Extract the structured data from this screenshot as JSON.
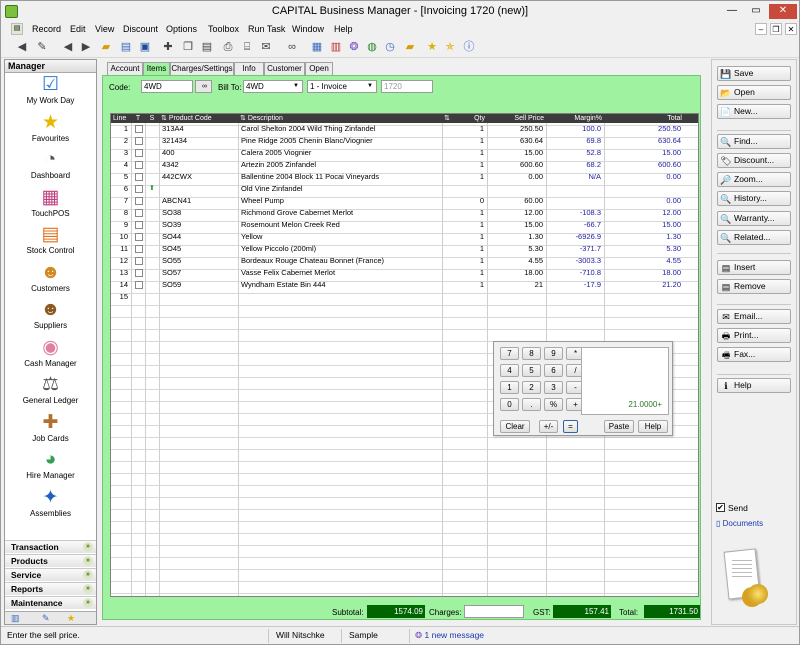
{
  "window": {
    "title": "CAPITAL Business Manager - [Invoicing 1720 (new)]",
    "minimize": "—",
    "restore": "▭",
    "close": "✕",
    "child_minimize": "–",
    "child_restore": "❐",
    "child_close": "✕"
  },
  "menu": [
    "Record",
    "Edit",
    "View",
    "Discount",
    "Options",
    "Toolbox",
    "Run Task",
    "Window",
    "Help"
  ],
  "left_panel": {
    "header": "Manager",
    "items": [
      {
        "label": "My Work Day",
        "icon": "☑",
        "color": "#2d7ad6"
      },
      {
        "label": "Favourites",
        "icon": "★",
        "color": "#e6b800"
      },
      {
        "label": "Dashboard",
        "icon": "◔",
        "color": "#555555"
      },
      {
        "label": "TouchPOS",
        "icon": "▦",
        "color": "#c04080"
      },
      {
        "label": "Stock Control",
        "icon": "▤",
        "color": "#e07020"
      },
      {
        "label": "Customers",
        "icon": "☻",
        "color": "#d08a20"
      },
      {
        "label": "Suppliers",
        "icon": "☻",
        "color": "#8a5a20"
      },
      {
        "label": "Cash Manager",
        "icon": "◉",
        "color": "#e080a0"
      },
      {
        "label": "General Ledger",
        "icon": "⚖",
        "color": "#555555"
      },
      {
        "label": "Job Cards",
        "icon": "✚",
        "color": "#b07030"
      },
      {
        "label": "Hire Manager",
        "icon": "◕",
        "color": "#30a050"
      },
      {
        "label": "Assemblies",
        "icon": "✦",
        "color": "#2060c0"
      }
    ],
    "categories": [
      "Transaction",
      "Products",
      "Service",
      "Reports",
      "Maintenance"
    ]
  },
  "tabs": [
    "Account",
    "Items",
    "Charges/Settings",
    "Info",
    "Customer",
    "Open"
  ],
  "active_tab": "Items",
  "header": {
    "code_label": "Code:",
    "code_value": "4WD",
    "bill_to_label": "Bill To:",
    "bill_to_value": "4WD",
    "doc_type": "1 - Invoice",
    "doc_number": "1720"
  },
  "grid": {
    "columns": [
      "Line",
      "T",
      "S",
      "Product Code",
      "Description",
      "Qty",
      "Sell Price",
      "Margin%",
      "Total"
    ],
    "rows": [
      {
        "line": "1",
        "arrow": "",
        "code": "313A4",
        "desc": "Carol Shelton 2004 Wild Thing Zinfandel",
        "qty": "1",
        "price": "250.50",
        "margin": "100.0",
        "total": "250.50"
      },
      {
        "line": "2",
        "arrow": "",
        "code": "321434",
        "desc": "Pine Ridge 2005 Chenin Blanc/Viognier",
        "qty": "1",
        "price": "630.64",
        "margin": "69.8",
        "total": "630.64"
      },
      {
        "line": "3",
        "arrow": "",
        "code": "400",
        "desc": "Calera 2005 Viognier",
        "qty": "1",
        "price": "15.00",
        "margin": "52.8",
        "total": "15.00"
      },
      {
        "line": "4",
        "arrow": "",
        "code": "4342",
        "desc": "Artezin 2005 Zinfandel",
        "qty": "1",
        "price": "600.60",
        "margin": "68.2",
        "total": "600.60"
      },
      {
        "line": "5",
        "arrow": "",
        "code": "442CWX",
        "desc": "Ballentine 2004 Block 11 Pocai Vineyards",
        "qty": "1",
        "price": "0.00",
        "margin": "N/A",
        "total": "0.00"
      },
      {
        "line": "6",
        "arrow": "⬆",
        "code": "",
        "desc": "Old Vine Zinfandel",
        "qty": "",
        "price": "",
        "margin": "",
        "total": ""
      },
      {
        "line": "7",
        "arrow": "",
        "code": "ABCN41",
        "desc": "Wheel Pump",
        "qty": "0",
        "price": "60.00",
        "margin": "",
        "total": "0.00"
      },
      {
        "line": "8",
        "arrow": "",
        "code": "SO38",
        "desc": "Richmond Grove Cabernet Merlot",
        "qty": "1",
        "price": "12.00",
        "margin": "-108.3",
        "total": "12.00"
      },
      {
        "line": "9",
        "arrow": "",
        "code": "SO39",
        "desc": "Rosemount Melon Creek Red",
        "qty": "1",
        "price": "15.00",
        "margin": "-66.7",
        "total": "15.00"
      },
      {
        "line": "10",
        "arrow": "",
        "code": "SO44",
        "desc": "Yellow",
        "qty": "1",
        "price": "1.30",
        "margin": "-6926.9",
        "total": "1.30"
      },
      {
        "line": "11",
        "arrow": "",
        "code": "SO45",
        "desc": "Yellow Piccolo (200ml)",
        "qty": "1",
        "price": "5.30",
        "margin": "-371.7",
        "total": "5.30"
      },
      {
        "line": "12",
        "arrow": "",
        "code": "SO55",
        "desc": "Bordeaux Rouge Chateau Bonnet (France)",
        "qty": "1",
        "price": "4.55",
        "margin": "-3003.3",
        "total": "4.55"
      },
      {
        "line": "13",
        "arrow": "",
        "code": "SO57",
        "desc": "Vasse Felix Cabernet Merlot",
        "qty": "1",
        "price": "18.00",
        "margin": "-710.8",
        "total": "18.00"
      },
      {
        "line": "14",
        "arrow": "",
        "code": "SO59",
        "desc": "Wyndham Estate Bin 444",
        "qty": "1",
        "price": "21",
        "margin": "-17.9",
        "total": "21.20"
      },
      {
        "line": "15",
        "arrow": "",
        "code": "",
        "desc": "",
        "qty": "",
        "price": "",
        "margin": "",
        "total": ""
      }
    ]
  },
  "calculator": {
    "keys": [
      [
        "7",
        "8",
        "9",
        "*"
      ],
      [
        "4",
        "5",
        "6",
        "/"
      ],
      [
        "1",
        "2",
        "3",
        "-"
      ],
      [
        "0",
        ".",
        "%",
        "+"
      ]
    ],
    "clear": "Clear",
    "plus_minus": "+/-",
    "equals": "=",
    "paste": "Paste",
    "help": "Help",
    "display": "21.0000+"
  },
  "totals": {
    "subtotal_label": "Subtotal:",
    "subtotal": "1574.09",
    "charges_label": "Charges:",
    "charges": "",
    "gst_label": "GST:",
    "gst": "157.41",
    "total_label": "Total:",
    "total": "1731.50"
  },
  "right_panel": {
    "buttons": [
      {
        "label": "Save",
        "icon": "💾"
      },
      {
        "label": "Open",
        "icon": "📂"
      },
      {
        "label": "New...",
        "icon": "📄"
      },
      {
        "label": "Find...",
        "icon": "🔍"
      },
      {
        "label": "Discount...",
        "icon": "🏷"
      },
      {
        "label": "Zoom...",
        "icon": "🔎"
      },
      {
        "label": "History...",
        "icon": "🔍"
      },
      {
        "label": "Warranty...",
        "icon": "🔍"
      },
      {
        "label": "Related...",
        "icon": "🔍"
      },
      {
        "label": "Insert",
        "icon": "▤"
      },
      {
        "label": "Remove",
        "icon": "▤"
      },
      {
        "label": "Email...",
        "icon": "✉"
      },
      {
        "label": "Print...",
        "icon": "🖶"
      },
      {
        "label": "Fax...",
        "icon": "🖷"
      },
      {
        "label": "Help",
        "icon": "ℹ"
      }
    ],
    "send_label": "Send",
    "documents_label": "Documents"
  },
  "status": {
    "hint": "Enter the sell price.",
    "user": "Will Nitschke",
    "company": "Sample",
    "messages": "1 new message"
  }
}
